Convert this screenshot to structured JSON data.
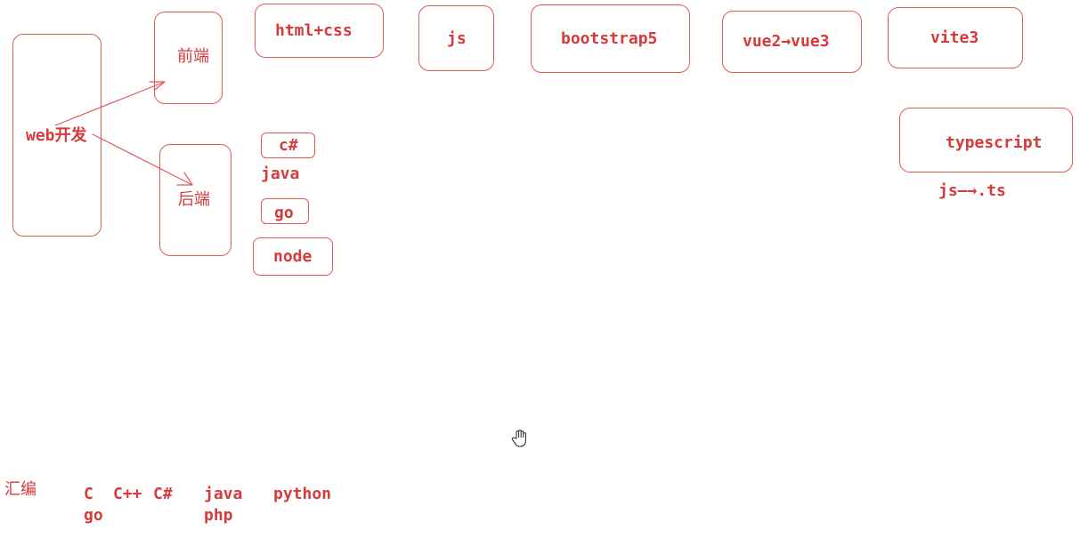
{
  "colors": {
    "ink": "#d63a3a",
    "stroke": "#e05a5a"
  },
  "nodes": {
    "web": "web开发",
    "frontend": "前端",
    "backend": "后端",
    "html_css": "html+css",
    "js": "js",
    "bootstrap": "bootstrap5",
    "vue": "vue2→vue3",
    "vite": "vite3",
    "typescript": "typescript",
    "js_to_ts": "js—→.ts",
    "csharp": "c#",
    "java": "java",
    "go": "go",
    "node": "node"
  },
  "languages": {
    "assembly": "汇编",
    "c": "C",
    "cpp": "C++",
    "csharp": "C#",
    "java": "java",
    "python": "python",
    "go": "go",
    "php": "php"
  },
  "icons": {
    "cursor": "hand-cursor-icon"
  }
}
